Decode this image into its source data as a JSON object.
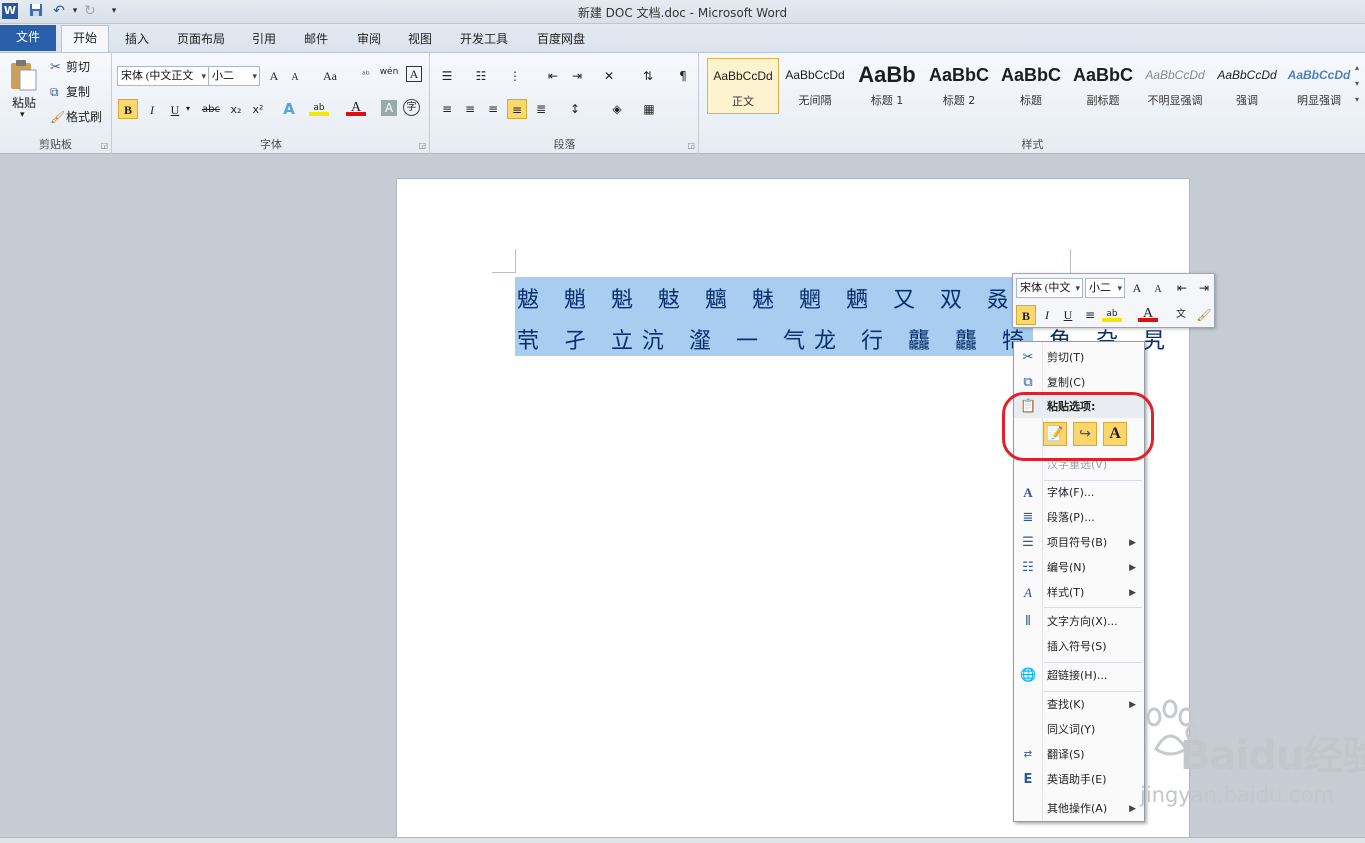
{
  "window": {
    "title": "新建 DOC 文档.doc - Microsoft Word"
  },
  "qat": {
    "word_logo": "W",
    "save_icon": "save-icon",
    "undo_icon": "undo-icon",
    "redo_icon": "redo-icon",
    "customize": "▾"
  },
  "tabs": [
    {
      "label": "文件"
    },
    {
      "label": "开始"
    },
    {
      "label": "插入"
    },
    {
      "label": "页面布局"
    },
    {
      "label": "引用"
    },
    {
      "label": "邮件"
    },
    {
      "label": "审阅"
    },
    {
      "label": "视图"
    },
    {
      "label": "开发工具"
    },
    {
      "label": "百度网盘"
    }
  ],
  "clipboard": {
    "paste": "粘贴",
    "cut": "剪切",
    "copy": "复制",
    "format_painter": "格式刷",
    "group": "剪贴板"
  },
  "font": {
    "name": "宋体 (中文正文",
    "size": "小二",
    "grow": "A",
    "shrink": "A",
    "case": "Aa",
    "pinyin": "wén",
    "char_border": "A",
    "bold": "B",
    "italic": "I",
    "underline": "U",
    "strike": "abc",
    "sub": "x₂",
    "sup": "x²",
    "group": "字体"
  },
  "paragraph": {
    "group": "段落"
  },
  "styles": {
    "group": "样式",
    "items": [
      {
        "preview": "AaBbCcDd",
        "name": "正文"
      },
      {
        "preview": "AaBbCcDd",
        "name": "无间隔"
      },
      {
        "preview": "AaBb",
        "name": "标题 1"
      },
      {
        "preview": "AaBbC",
        "name": "标题 2"
      },
      {
        "preview": "AaBbC",
        "name": "标题"
      },
      {
        "preview": "AaBbC",
        "name": "副标题"
      },
      {
        "preview": "AaBbCcDd",
        "name": "不明显强调"
      },
      {
        "preview": "AaBbCcDd",
        "name": "强调"
      },
      {
        "preview": "AaBbCcDd",
        "name": "明显强调"
      }
    ]
  },
  "document": {
    "line1": "魃 魈 魁 鬾 魑 魅 魍 魉 又 双 叒 叕 幸",
    "line2": "茕 孑 立沆 瀣 一 气龙 行 龘 龘 犄 角 旮 旯"
  },
  "mini_toolbar": {
    "font": "宋体 (中文",
    "size": "小二",
    "bold": "B",
    "italic": "I",
    "underline": "U",
    "grow": "A",
    "shrink": "A"
  },
  "context_menu": {
    "items": [
      {
        "label": "剪切(T)",
        "icon": "scissors-icon"
      },
      {
        "label": "复制(C)",
        "icon": "copy-icon"
      },
      {
        "label": "粘贴选项:",
        "icon": "paste-icon"
      },
      {
        "label": "汉字重选(V)",
        "icon": ""
      },
      {
        "label": "字体(F)...",
        "icon": "font-icon"
      },
      {
        "label": "段落(P)...",
        "icon": "paragraph-icon"
      },
      {
        "label": "项目符号(B)",
        "icon": "bullets-icon"
      },
      {
        "label": "编号(N)",
        "icon": "numbering-icon"
      },
      {
        "label": "样式(T)",
        "icon": "styles-icon"
      },
      {
        "label": "文字方向(X)...",
        "icon": "text-direction-icon"
      },
      {
        "label": "插入符号(S)",
        "icon": ""
      },
      {
        "label": "超链接(H)...",
        "icon": "hyperlink-icon"
      },
      {
        "label": "查找(K)",
        "icon": ""
      },
      {
        "label": "同义词(Y)",
        "icon": ""
      },
      {
        "label": "翻译(S)",
        "icon": "translate-icon"
      },
      {
        "label": "英语助手(E)",
        "icon": "english-assistant-icon"
      },
      {
        "label": "其他操作(A)",
        "icon": ""
      }
    ]
  },
  "watermark": {
    "brand": "Baidu经验",
    "url": "jingyan.baidu.com"
  },
  "colors": {
    "accent": "#2a5ea8",
    "selection": "#a8cdf1",
    "highlight": "#e0212a"
  }
}
